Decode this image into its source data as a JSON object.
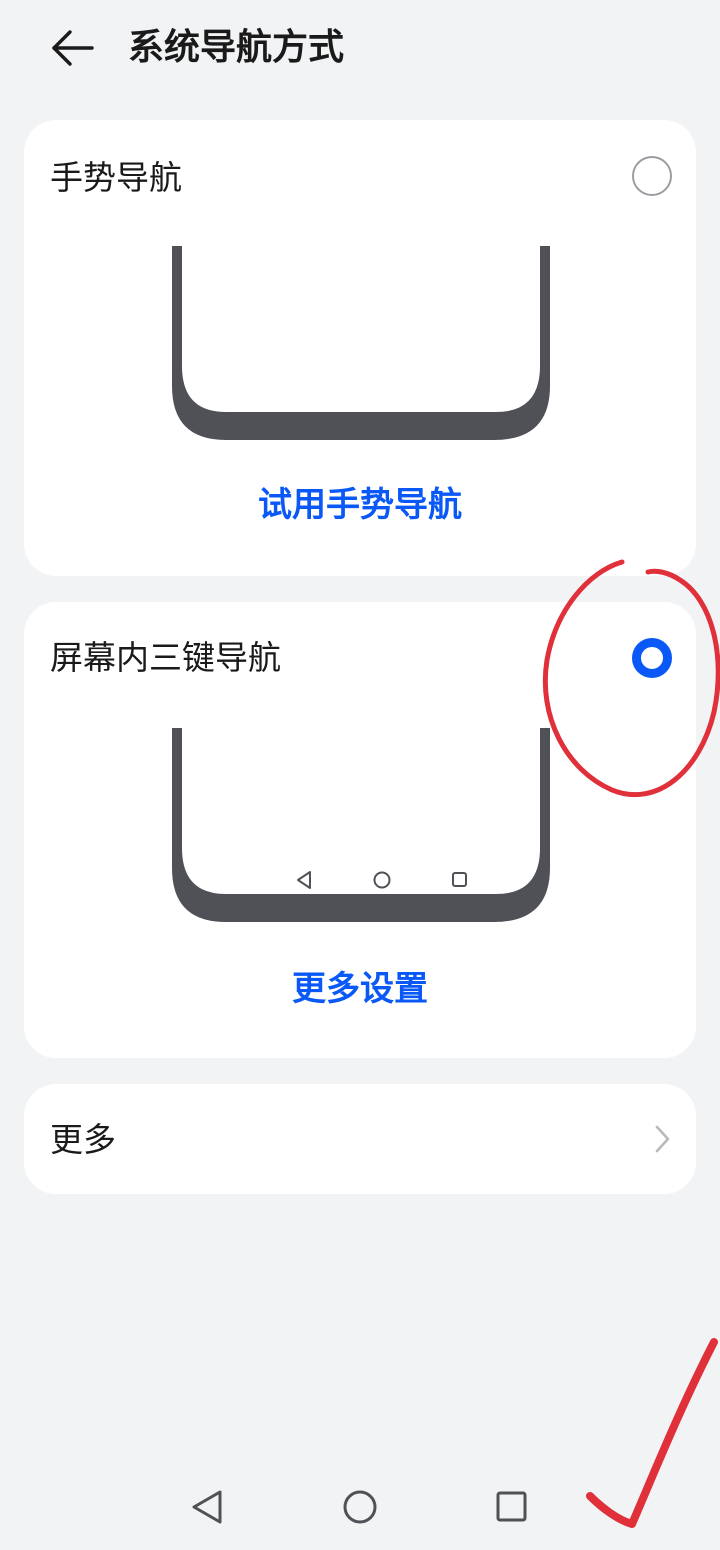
{
  "header": {
    "title": "系统导航方式",
    "back_icon": "arrow-left"
  },
  "options": [
    {
      "title": "手势导航",
      "selected": false,
      "link_label": "试用手势导航"
    },
    {
      "title": "屏幕内三键导航",
      "selected": true,
      "link_label": "更多设置"
    }
  ],
  "more": {
    "label": "更多",
    "chevron_icon": "chevron-right"
  },
  "system_nav": {
    "icons": [
      "back-triangle",
      "home-circle",
      "recents-square"
    ]
  },
  "colors": {
    "background": "#f1f3f5",
    "card": "#ffffff",
    "accent": "#0a59f7",
    "annotation": "#e0303a"
  }
}
